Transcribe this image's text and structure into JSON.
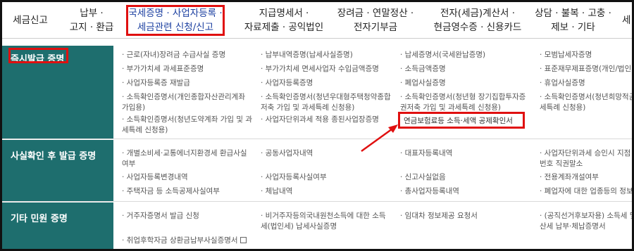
{
  "top_nav": {
    "items": [
      {
        "label": [
          "세금신고"
        ]
      },
      {
        "label": [
          "납부 ·",
          "고지 · 환급"
        ]
      },
      {
        "label": [
          "국세증명 · 사업자등록 ·",
          "세금관련 신청/신고"
        ]
      },
      {
        "label": [
          "지급명세서 ·",
          "자료제출 · 공익법인"
        ]
      },
      {
        "label": [
          "장려금 · 연말정산 ·",
          "전자기부금"
        ]
      },
      {
        "label": [
          "전자(세금)계산서 ·",
          "현금영수증 · 신용카드"
        ]
      },
      {
        "label": [
          "상담 · 불복 · 고충 ·",
          "제보 · 기타"
        ]
      },
      {
        "label": [
          "세"
        ]
      }
    ]
  },
  "sections": [
    {
      "category": "즉시발급 증명",
      "columns": [
        [
          "· 근로(자녀)장려금 수급사실 증명",
          "· 부가가치세 과세표준증명",
          "· 사업자등록증 재발급",
          [
            "· 소득확인증명서(개인종합자산관리계좌",
            "  가입용)"
          ],
          [
            "· 소득확인증명서(청년도약계좌 가입 및 과",
            "  세특례 신청용)"
          ]
        ],
        [
          "· 납부내역증명(납세사실증명)",
          "· 부가가치세 면세사업자 수입금액증명",
          "· 사업자등록증명",
          [
            "· 소득확인증명서(청년우대형주택청약종합",
            "  저축 가입 및 과세특례 신청용)"
          ],
          "· 사업자단위과세 적용 종된사업장증명"
        ],
        [
          "· 납세증명서(국세완납증명)",
          "· 소득금액증명",
          "· 폐업사실증명",
          [
            "· 소득확인증명서(청년형 장기집합투자증",
            "  권저축 가입 및 과세특례 신청용)"
          ],
          "연금보험료등 소득·세액 공제확인서"
        ],
        [
          "· 모범납세자증명",
          "· 표준재무제표증명(개인/법인",
          "· 휴업사실증명",
          [
            "· 소득확인증명서(청년희망적금",
            "  세특례 신청용)"
          ]
        ]
      ]
    },
    {
      "category": "사실확인 후 발급 증명",
      "columns": [
        [
          [
            "· 개별소비세·교통에너지환경세 환급사실",
            "  여부"
          ],
          "· 사업자등록변경내역",
          "· 주택자금 등 소득공제사실여부"
        ],
        [
          "· 공동사업자내역",
          "· 사업자등록사실여부",
          "· 체납내역"
        ],
        [
          "· 대표자등록내역",
          "· 신고사실없음",
          "· 총사업자등록내역"
        ],
        [
          [
            "· 사업자단위과세 승인시 지점",
            "  번호 직권말소"
          ],
          "· 전용계좌개설여부",
          "· 폐업자에 대한 업종등의 정보"
        ]
      ]
    },
    {
      "category": "기타 민원 증명",
      "columns": [
        [
          "· 거주자증명서 발급 신청",
          "· 취업후학자금 상환금납부사실증명서"
        ],
        [
          [
            "· 비거주자등의국내원천소득에 대한 소득",
            "  세(법인세) 납세사실증명"
          ]
        ],
        [
          "· 임대차 정보제공 요청서"
        ],
        [
          [
            "· (공직선거후보자용) 소득세 및",
            "  산세 납부·체납증명서"
          ]
        ]
      ]
    }
  ],
  "colors": {
    "category_bg": "#1e6e6e",
    "highlight": "#e01010",
    "active_nav": "#1b3fa0"
  }
}
